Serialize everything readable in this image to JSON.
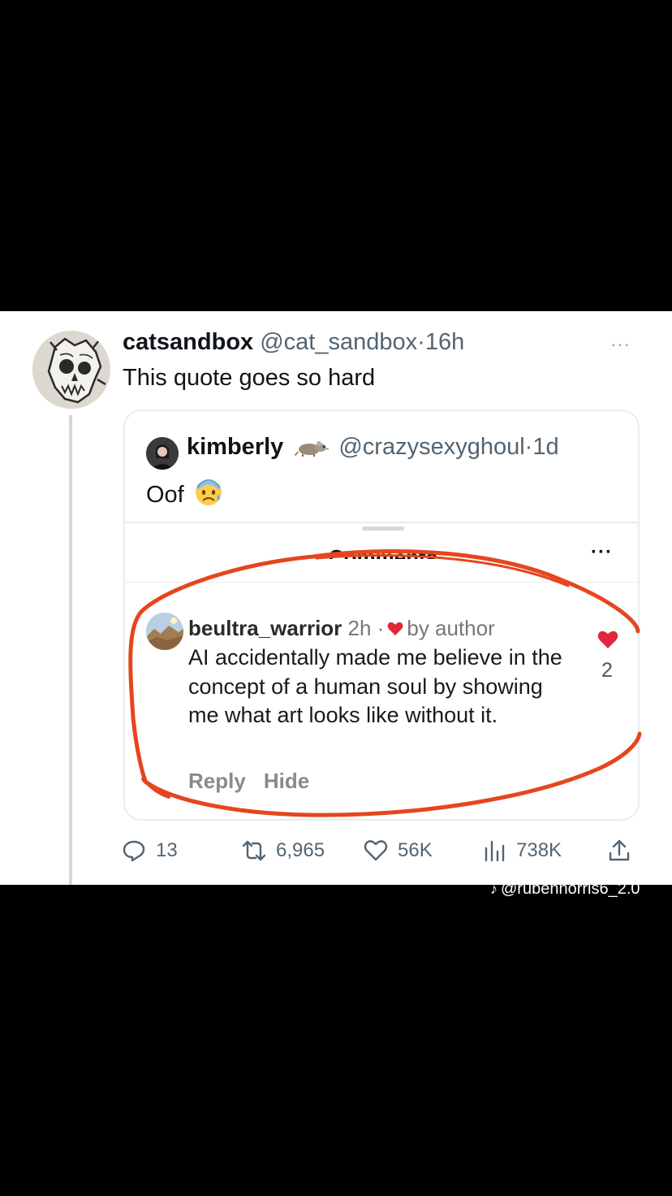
{
  "tweet": {
    "display_name": "catsandbox",
    "handle": "@cat_sandbox",
    "separator": "·",
    "time": "16h",
    "text": "This quote goes so hard",
    "more": "···"
  },
  "quote": {
    "display_name": "kimberly",
    "handle": "@crazysexyghoul",
    "separator": "·",
    "time": "1d",
    "text": "Oof"
  },
  "embed": {
    "title": "Comments",
    "more": "···",
    "comment": {
      "username": "beultra_warrior",
      "time": "2h",
      "separator": "·",
      "badge": "by author",
      "body": "AI accidentally made me believe in the concept of a human soul by showing me what art looks like without it.",
      "reply_label": "Reply",
      "hide_label": "Hide",
      "like_count": "2"
    }
  },
  "actions": {
    "replies": "13",
    "reposts": "6,965",
    "likes": "56K",
    "views": "738K"
  },
  "watermark": {
    "text": "@rubennorris6_2.0"
  },
  "colors": {
    "annotation_red": "#e5461f",
    "heart_red": "#e0283a",
    "secondary_text": "#536471"
  }
}
